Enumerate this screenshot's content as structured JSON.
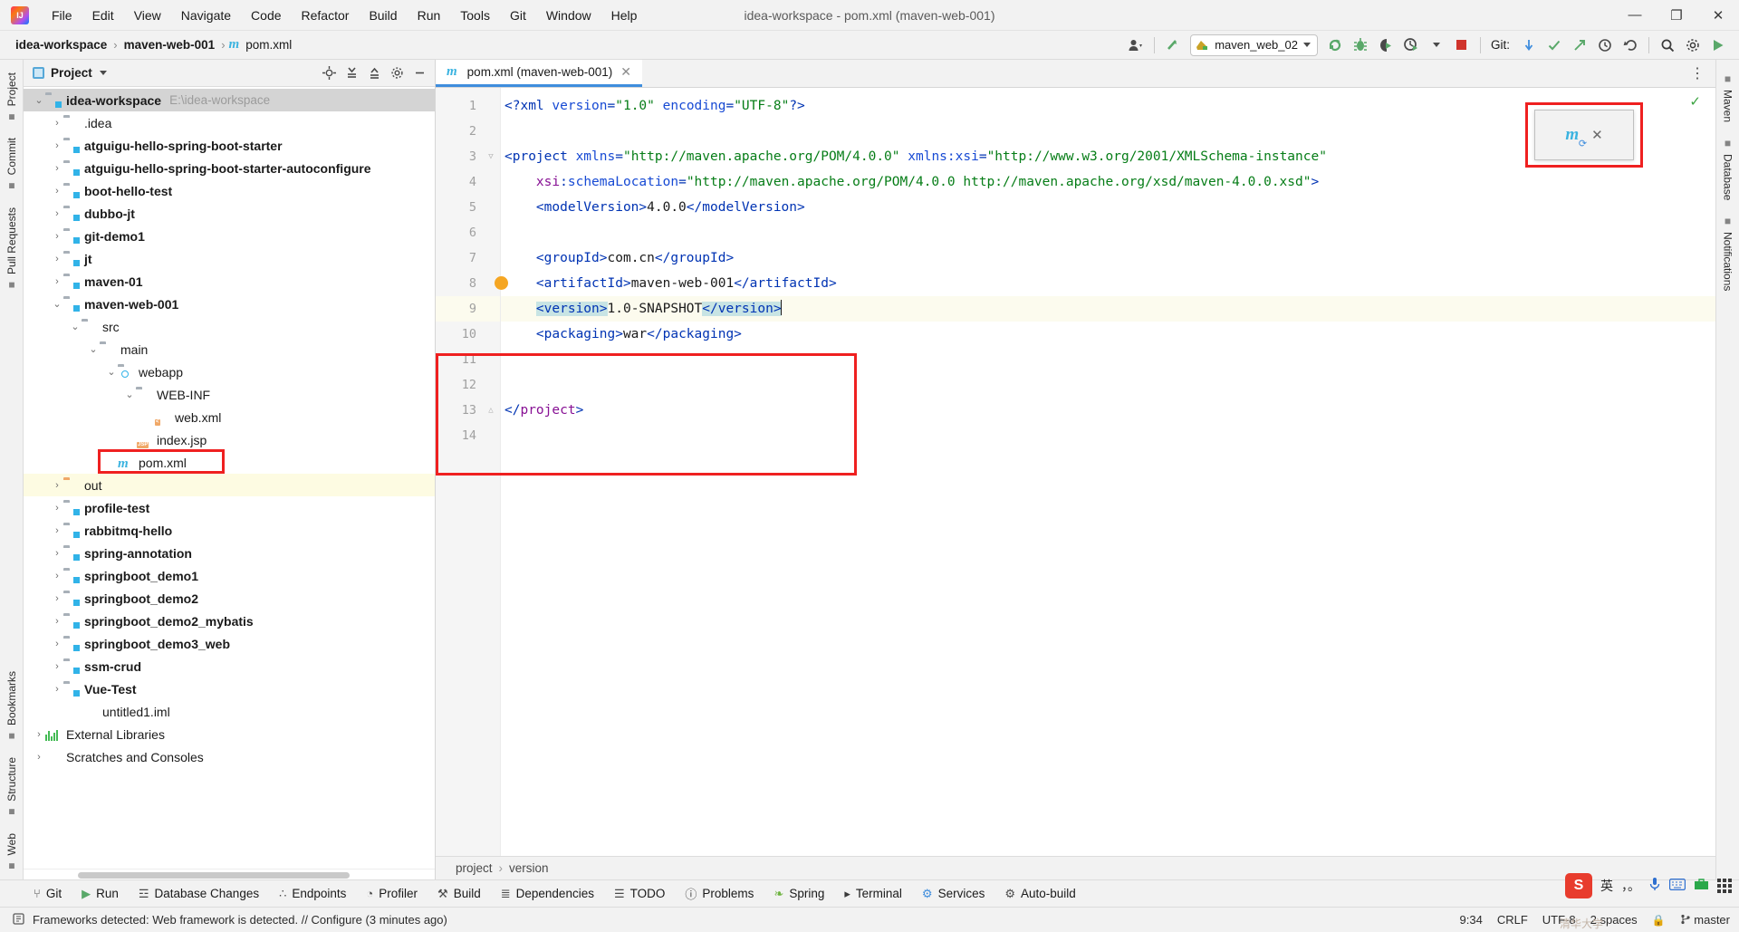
{
  "window": {
    "title": "idea-workspace - pom.xml (maven-web-001)",
    "minimize": "—",
    "maximize": "❐",
    "close": "✕"
  },
  "menu": [
    {
      "label": "File"
    },
    {
      "label": "Edit"
    },
    {
      "label": "View"
    },
    {
      "label": "Navigate"
    },
    {
      "label": "Code"
    },
    {
      "label": "Refactor"
    },
    {
      "label": "Build"
    },
    {
      "label": "Run"
    },
    {
      "label": "Tools"
    },
    {
      "label": "Git"
    },
    {
      "label": "Window"
    },
    {
      "label": "Help"
    }
  ],
  "navbar": {
    "breadcrumb": [
      "idea-workspace",
      "maven-web-001",
      "pom.xml"
    ],
    "separator": "›",
    "run_config": "maven_web_02",
    "git_label": "Git:",
    "icons": {
      "profile": "user-profile-icon",
      "updates": "update-project-icon",
      "rerun": "rerun-icon",
      "debug": "debug-icon",
      "coverage": "run-with-coverage-icon",
      "profiler": "profiler-icon",
      "stop": "stop-icon",
      "commit": "git-commit-icon",
      "check": "git-update-icon",
      "push": "git-push-icon",
      "history": "history-icon",
      "undo": "undo-icon",
      "search": "search-everywhere-icon",
      "settings": "settings-icon",
      "run": "run-icon"
    }
  },
  "rail_left": [
    {
      "label": "Project",
      "icon": "project-icon"
    },
    {
      "label": "Commit",
      "icon": "commit-icon"
    },
    {
      "label": "Pull Requests",
      "icon": "pull-requests-icon"
    },
    {
      "label": "Bookmarks",
      "icon": "bookmarks-icon"
    },
    {
      "label": "Structure",
      "icon": "structure-icon"
    },
    {
      "label": "Web",
      "icon": "web-icon"
    }
  ],
  "rail_right": [
    {
      "label": "Maven",
      "icon": "maven-icon"
    },
    {
      "label": "Database",
      "icon": "database-icon"
    },
    {
      "label": "Notifications",
      "icon": "notifications-icon"
    }
  ],
  "project_panel": {
    "title": "Project",
    "dropdown_caret": "▾",
    "tools": [
      "locate-icon",
      "expand-all-icon",
      "collapse-all-icon",
      "settings-icon",
      "hide-icon"
    ],
    "tree": [
      {
        "label": "idea-workspace",
        "path": "E:\\idea-workspace",
        "indent": 0,
        "arrow": "⌄",
        "icon": "module-folder",
        "bold": true,
        "state": "sel"
      },
      {
        "label": ".idea",
        "indent": 1,
        "arrow": "›",
        "icon": "folder",
        "bold": false,
        "state": ""
      },
      {
        "label": "atguigu-hello-spring-boot-starter",
        "indent": 1,
        "arrow": "›",
        "icon": "module-folder",
        "bold": true,
        "state": ""
      },
      {
        "label": "atguigu-hello-spring-boot-starter-autoconfigure",
        "indent": 1,
        "arrow": "›",
        "icon": "module-folder",
        "bold": true,
        "state": ""
      },
      {
        "label": "boot-hello-test",
        "indent": 1,
        "arrow": "›",
        "icon": "module-folder",
        "bold": true,
        "state": ""
      },
      {
        "label": "dubbo-jt",
        "indent": 1,
        "arrow": "›",
        "icon": "module-folder",
        "bold": true,
        "state": ""
      },
      {
        "label": "git-demo1",
        "indent": 1,
        "arrow": "›",
        "icon": "module-folder",
        "bold": true,
        "state": ""
      },
      {
        "label": "jt",
        "indent": 1,
        "arrow": "›",
        "icon": "module-folder",
        "bold": true,
        "state": ""
      },
      {
        "label": "maven-01",
        "indent": 1,
        "arrow": "›",
        "icon": "module-folder",
        "bold": true,
        "state": ""
      },
      {
        "label": "maven-web-001",
        "indent": 1,
        "arrow": "⌄",
        "icon": "module-folder",
        "bold": true,
        "state": ""
      },
      {
        "label": "src",
        "indent": 2,
        "arrow": "⌄",
        "icon": "folder",
        "bold": false,
        "state": ""
      },
      {
        "label": "main",
        "indent": 3,
        "arrow": "⌄",
        "icon": "folder",
        "bold": false,
        "state": ""
      },
      {
        "label": "webapp",
        "indent": 4,
        "arrow": "⌄",
        "icon": "webapp-folder",
        "bold": false,
        "state": ""
      },
      {
        "label": "WEB-INF",
        "indent": 5,
        "arrow": "⌄",
        "icon": "folder",
        "bold": false,
        "state": ""
      },
      {
        "label": "web.xml",
        "indent": 6,
        "arrow": "",
        "icon": "xml-file",
        "badge": "<",
        "bold": false,
        "state": ""
      },
      {
        "label": "index.jsp",
        "indent": 5,
        "arrow": "",
        "icon": "jsp-file",
        "badge": "JSP",
        "bold": false,
        "state": ""
      },
      {
        "label": "pom.xml",
        "indent": 4,
        "arrow": "",
        "icon": "maven-file",
        "bold": false,
        "state": "",
        "highlight_box": true
      },
      {
        "label": "out",
        "indent": 1,
        "arrow": "›",
        "icon": "out-folder",
        "bold": false,
        "state": "hl"
      },
      {
        "label": "profile-test",
        "indent": 1,
        "arrow": "›",
        "icon": "module-folder",
        "bold": true,
        "state": ""
      },
      {
        "label": "rabbitmq-hello",
        "indent": 1,
        "arrow": "›",
        "icon": "module-folder",
        "bold": true,
        "state": ""
      },
      {
        "label": "spring-annotation",
        "indent": 1,
        "arrow": "›",
        "icon": "module-folder",
        "bold": true,
        "state": ""
      },
      {
        "label": "springboot_demo1",
        "indent": 1,
        "arrow": "›",
        "icon": "module-folder",
        "bold": true,
        "state": ""
      },
      {
        "label": "springboot_demo2",
        "indent": 1,
        "arrow": "›",
        "icon": "module-folder",
        "bold": true,
        "state": ""
      },
      {
        "label": "springboot_demo2_mybatis",
        "indent": 1,
        "arrow": "›",
        "icon": "module-folder",
        "bold": true,
        "state": ""
      },
      {
        "label": "springboot_demo3_web",
        "indent": 1,
        "arrow": "›",
        "icon": "module-folder",
        "bold": true,
        "state": ""
      },
      {
        "label": "ssm-crud",
        "indent": 1,
        "arrow": "›",
        "icon": "module-folder",
        "bold": true,
        "state": ""
      },
      {
        "label": "Vue-Test",
        "indent": 1,
        "arrow": "›",
        "icon": "module-folder",
        "bold": true,
        "state": ""
      },
      {
        "label": "untitled1.iml",
        "indent": 2,
        "arrow": "",
        "icon": "iml-file",
        "bold": false,
        "state": ""
      },
      {
        "label": "External Libraries",
        "indent": 0,
        "arrow": "›",
        "icon": "library-icon",
        "bold": false,
        "state": ""
      },
      {
        "label": "Scratches and Consoles",
        "indent": 0,
        "arrow": "›",
        "icon": "scratches-icon",
        "bold": false,
        "state": ""
      }
    ]
  },
  "editor": {
    "tab": {
      "title": "pom.xml (maven-web-001)",
      "icon": "maven-file-icon",
      "close": "✕"
    },
    "more_icon": "⋮",
    "inspection_ok": "✓",
    "maven_popup": {
      "icon": "maven-reload-icon",
      "close": "✕"
    },
    "line_numbers": [
      1,
      2,
      3,
      4,
      5,
      6,
      7,
      8,
      9,
      10,
      11,
      12,
      13,
      14
    ],
    "current_line": 9,
    "lines": [
      {
        "n": 1,
        "segments": [
          {
            "t": "<?xml ",
            "c": "tag"
          },
          {
            "t": "version",
            "c": "attr"
          },
          {
            "t": "=",
            "c": "punct"
          },
          {
            "t": "\"1.0\"",
            "c": "str"
          },
          {
            "t": " ",
            "c": "txt"
          },
          {
            "t": "encoding",
            "c": "attr"
          },
          {
            "t": "=",
            "c": "punct"
          },
          {
            "t": "\"UTF-8\"",
            "c": "str"
          },
          {
            "t": "?>",
            "c": "tag"
          }
        ]
      },
      {
        "n": 2,
        "segments": []
      },
      {
        "n": 3,
        "segments": [
          {
            "t": "<project ",
            "c": "tag"
          },
          {
            "t": "xmlns",
            "c": "attr"
          },
          {
            "t": "=",
            "c": "punct"
          },
          {
            "t": "\"http://maven.apache.org/POM/4.0.0\"",
            "c": "str"
          },
          {
            "t": " ",
            "c": "txt"
          },
          {
            "t": "xmlns:xsi",
            "c": "attr"
          },
          {
            "t": "=",
            "c": "punct"
          },
          {
            "t": "\"http://www.w3.org/2001/XMLSchema-instance\"",
            "c": "str"
          }
        ]
      },
      {
        "n": 4,
        "segments": [
          {
            "t": "    ",
            "c": "txt"
          },
          {
            "t": "xsi",
            "c": "pink"
          },
          {
            "t": ":",
            "c": "punct"
          },
          {
            "t": "schemaLocation",
            "c": "attr"
          },
          {
            "t": "=",
            "c": "punct"
          },
          {
            "t": "\"http://maven.apache.org/POM/4.0.0 http://maven.apache.org/xsd/maven-4.0.0.xsd\"",
            "c": "str"
          },
          {
            "t": ">",
            "c": "tag"
          }
        ]
      },
      {
        "n": 5,
        "segments": [
          {
            "t": "    ",
            "c": "txt"
          },
          {
            "t": "<modelVersion>",
            "c": "tag"
          },
          {
            "t": "4.0.0",
            "c": "txt"
          },
          {
            "t": "</modelVersion>",
            "c": "tag"
          }
        ]
      },
      {
        "n": 6,
        "segments": []
      },
      {
        "n": 7,
        "segments": [
          {
            "t": "    ",
            "c": "txt"
          },
          {
            "t": "<groupId>",
            "c": "tag"
          },
          {
            "t": "com.cn",
            "c": "txt"
          },
          {
            "t": "</groupId>",
            "c": "tag"
          }
        ]
      },
      {
        "n": 8,
        "segments": [
          {
            "t": "    ",
            "c": "txt"
          },
          {
            "t": "<artifactId>",
            "c": "tag"
          },
          {
            "t": "maven-web-001",
            "c": "txt"
          },
          {
            "t": "</artifactId>",
            "c": "tag"
          }
        ]
      },
      {
        "n": 9,
        "segments": [
          {
            "t": "    ",
            "c": "txt"
          },
          {
            "t": "<version>",
            "c": "tag",
            "sel": true
          },
          {
            "t": "1.0-SNAPSHOT",
            "c": "txt"
          },
          {
            "t": "</version>",
            "c": "tag",
            "sel": true
          },
          {
            "t": "",
            "c": "caret"
          }
        ]
      },
      {
        "n": 10,
        "segments": [
          {
            "t": "    ",
            "c": "txt"
          },
          {
            "t": "<packaging>",
            "c": "tag"
          },
          {
            "t": "war",
            "c": "txt"
          },
          {
            "t": "</packaging>",
            "c": "tag"
          }
        ]
      },
      {
        "n": 11,
        "segments": []
      },
      {
        "n": 12,
        "segments": []
      },
      {
        "n": 13,
        "segments": [
          {
            "t": "</",
            "c": "tag"
          },
          {
            "t": "project",
            "c": "pink"
          },
          {
            "t": ">",
            "c": "tag"
          }
        ]
      },
      {
        "n": 14,
        "segments": []
      }
    ],
    "breadcrumb": [
      "project",
      "version"
    ],
    "breadcrumb_sep": "›"
  },
  "tool_window_bar": [
    {
      "label": "Git",
      "icon": "git-branch-icon"
    },
    {
      "label": "Run",
      "icon": "run-icon"
    },
    {
      "label": "Database Changes",
      "icon": "database-changes-icon"
    },
    {
      "label": "Endpoints",
      "icon": "endpoints-icon"
    },
    {
      "label": "Profiler",
      "icon": "profiler-icon"
    },
    {
      "label": "Build",
      "icon": "build-hammer-icon"
    },
    {
      "label": "Dependencies",
      "icon": "dependencies-icon"
    },
    {
      "label": "TODO",
      "icon": "todo-icon"
    },
    {
      "label": "Problems",
      "icon": "problems-icon"
    },
    {
      "label": "Spring",
      "icon": "spring-leaf-icon"
    },
    {
      "label": "Terminal",
      "icon": "terminal-icon"
    },
    {
      "label": "Services",
      "icon": "services-icon"
    },
    {
      "label": "Auto-build",
      "icon": "auto-build-icon"
    }
  ],
  "status_bar": {
    "message": "Frameworks detected: Web framework is detected. // Configure (3 minutes ago)",
    "message_icon": "notification-icon",
    "position": "9:34",
    "line_separator": "CRLF",
    "encoding": "UTF-8",
    "indent": "2 spaces",
    "lock_icon": "🔒",
    "branch": "master",
    "branch_icon": "git-branch-icon",
    "watermark": "清华大学"
  },
  "ime": {
    "logo": "S",
    "mode": "英",
    "punct": "，。",
    "mic": "mic-icon",
    "keyboard": "keyboard-icon",
    "toolbox": "toolbox-icon",
    "menu": "grid-menu-icon"
  },
  "colors": {
    "accent": "#3f8ddd",
    "red_box": "#ef2020",
    "maven_blue": "#3bb3e0",
    "string_green": "#067d17",
    "tag_blue": "#0033b3",
    "attr_pink": "#871094",
    "highlight_yellow": "#fdfbe2",
    "selection_cyan": "#c8e4e4"
  }
}
